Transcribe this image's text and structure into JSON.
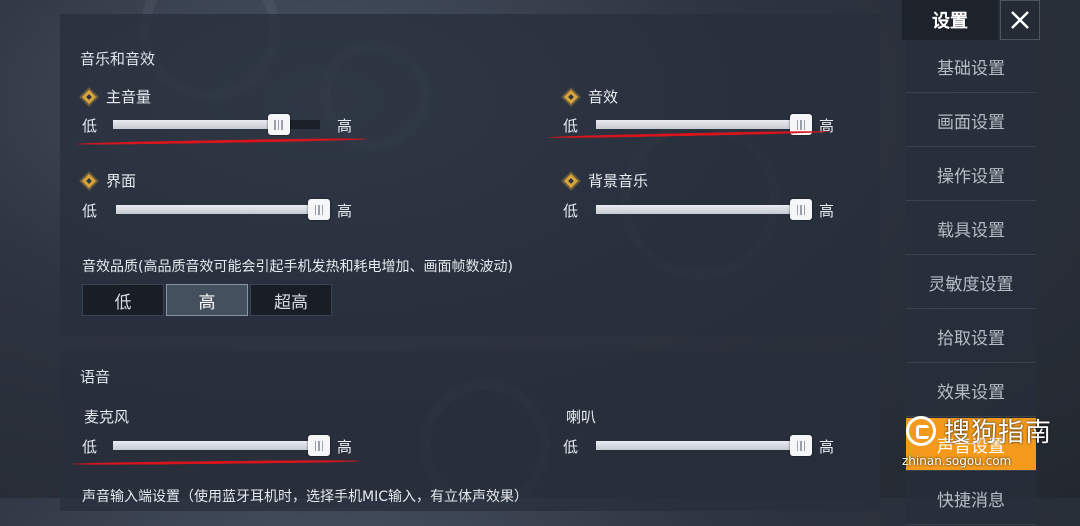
{
  "sections": {
    "audio_title": "音乐和音效",
    "voice_title": "语音"
  },
  "audio": {
    "main_volume": {
      "label": "主音量",
      "low": "低",
      "high": "高",
      "value": 0.8
    },
    "sfx": {
      "label": "音效",
      "low": "低",
      "high": "高",
      "value": 1.0
    },
    "ui": {
      "label": "界面",
      "low": "低",
      "high": "高",
      "value": 1.0
    },
    "bgm": {
      "label": "背景音乐",
      "low": "低",
      "high": "高",
      "value": 1.0
    }
  },
  "quality": {
    "description": "音效品质(高品质音效可能会引起手机发热和耗电增加、画面帧数波动)",
    "options": [
      "低",
      "高",
      "超高"
    ],
    "selected": "高"
  },
  "voice": {
    "mic": {
      "label": "麦克风",
      "low": "低",
      "high": "高",
      "value": 1.0
    },
    "speaker": {
      "label": "喇叭",
      "low": "低",
      "high": "高",
      "value": 1.0
    },
    "input_setting_partial": "声音输入端设置（使用蓝牙耳机时，选择手机MIC输入，有立体声效果）"
  },
  "menu": {
    "title": "设置",
    "close_icon": "close-icon",
    "items": [
      "基础设置",
      "画面设置",
      "操作设置",
      "载具设置",
      "灵敏度设置",
      "拾取设置",
      "效果设置",
      "声音设置",
      "快捷消息"
    ],
    "active": "声音设置"
  },
  "watermark": {
    "main": "搜狗指南",
    "sub": "zhinan.sogou.com"
  },
  "colors": {
    "accent_orange": "#f39a1c",
    "annotation_red": "#d8141d",
    "diamond_gold": "#d9a43a"
  }
}
